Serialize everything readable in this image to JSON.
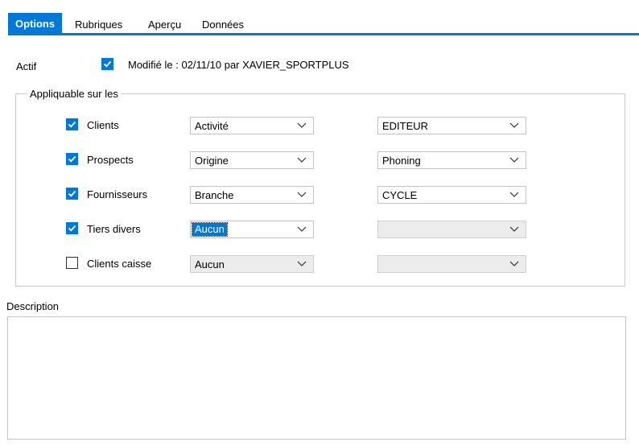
{
  "tabs": [
    {
      "label": "Options",
      "active": true
    },
    {
      "label": "Rubriques",
      "active": false
    },
    {
      "label": "Aperçu",
      "active": false
    },
    {
      "label": "Données",
      "active": false
    }
  ],
  "actif": {
    "label": "Actif",
    "checked": true,
    "modified_text": "Modifié le : 02/11/10 par XAVIER_SPORTPLUS"
  },
  "applicable": {
    "legend": "Appliquable sur les",
    "rows": [
      {
        "label": "Clients",
        "checked": true,
        "combo1": "Activité",
        "combo2": "EDITEUR"
      },
      {
        "label": "Prospects",
        "checked": true,
        "combo1": "Origine",
        "combo2": "Phoning"
      },
      {
        "label": "Fournisseurs",
        "checked": true,
        "combo1": "Branche",
        "combo2": "CYCLE"
      },
      {
        "label": "Tiers divers",
        "checked": true,
        "combo1": "Aucun",
        "combo2": ""
      },
      {
        "label": "Clients caisse",
        "checked": false,
        "combo1": "Aucun",
        "combo2": ""
      }
    ]
  },
  "description": {
    "label": "Description",
    "value": ""
  },
  "colors": {
    "accent": "#0078d7",
    "border": "#c4c4c4",
    "disabled": "#ececec"
  }
}
